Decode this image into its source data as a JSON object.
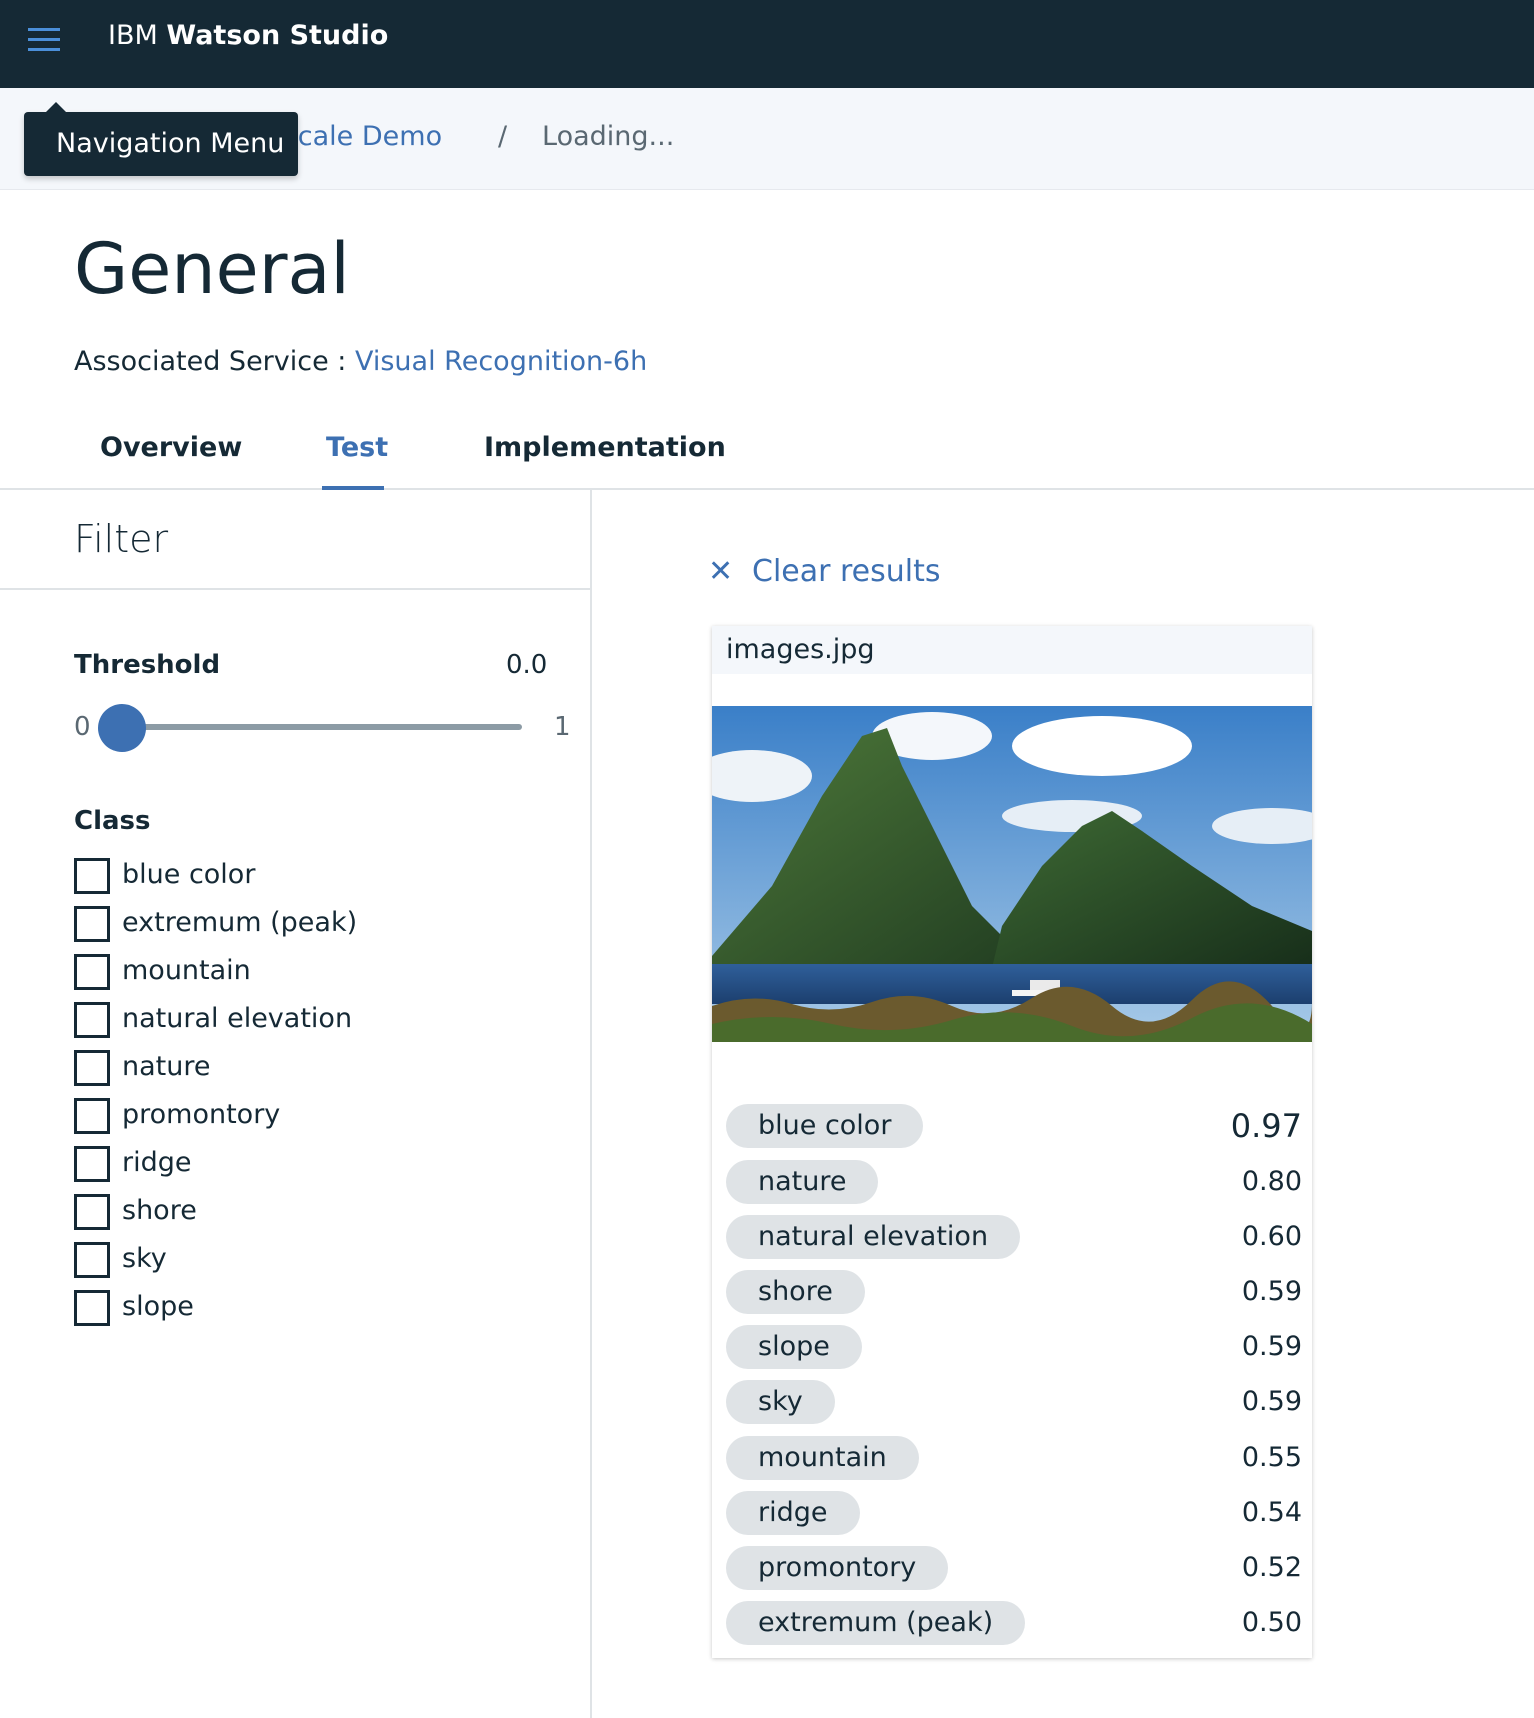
{
  "topbar": {
    "brand_light": "IBM ",
    "brand_bold": "Watson Studio",
    "menu_icon": "hamburger-menu-icon"
  },
  "tooltip": {
    "text": "Navigation Menu"
  },
  "breadcrumb": {
    "link": "enscale Demo",
    "separator": "/",
    "current": "Loading..."
  },
  "page": {
    "title": "General",
    "assoc_label": "Associated Service : ",
    "assoc_link": "Visual Recognition-6h"
  },
  "tabs": [
    {
      "label": "Overview",
      "active": false
    },
    {
      "label": "Test",
      "active": true
    },
    {
      "label": "Implementation",
      "active": false
    }
  ],
  "filter": {
    "title": "Filter",
    "threshold_label": "Threshold",
    "threshold_value": "0.0",
    "slider_min": "0",
    "slider_max": "1",
    "slider_level": 0.0,
    "class_label": "Class",
    "classes": [
      {
        "label": "blue color",
        "checked": false
      },
      {
        "label": "extremum (peak)",
        "checked": false
      },
      {
        "label": "mountain",
        "checked": false
      },
      {
        "label": "natural elevation",
        "checked": false
      },
      {
        "label": "nature",
        "checked": false
      },
      {
        "label": "promontory",
        "checked": false
      },
      {
        "label": "ridge",
        "checked": false
      },
      {
        "label": "shore",
        "checked": false
      },
      {
        "label": "sky",
        "checked": false
      },
      {
        "label": "slope",
        "checked": false
      }
    ]
  },
  "results": {
    "clear_label": "Clear results",
    "clear_icon": "close-icon",
    "filename": "images.jpg",
    "image_subject": "twin mountain peaks over water",
    "items": [
      {
        "label": "blue color",
        "score": "0.97"
      },
      {
        "label": "nature",
        "score": "0.80"
      },
      {
        "label": "natural elevation",
        "score": "0.60"
      },
      {
        "label": "shore",
        "score": "0.59"
      },
      {
        "label": "slope",
        "score": "0.59"
      },
      {
        "label": "sky",
        "score": "0.59"
      },
      {
        "label": "mountain",
        "score": "0.55"
      },
      {
        "label": "ridge",
        "score": "0.54"
      },
      {
        "label": "promontory",
        "score": "0.52"
      },
      {
        "label": "extremum (peak)",
        "score": "0.50"
      }
    ]
  },
  "colors": {
    "topbar": "#152935",
    "accent": "#3d70b2",
    "tag_bg": "#dfe3e6",
    "breadcrumb_bg": "#f4f7fb"
  }
}
